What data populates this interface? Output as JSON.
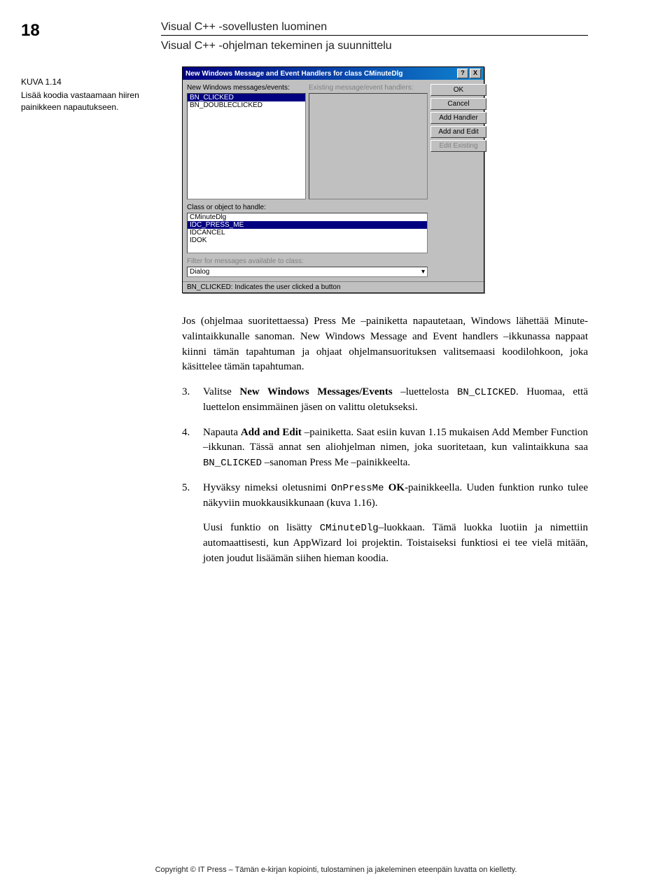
{
  "page_number": "18",
  "header": {
    "title1": "Visual C++ -sovellusten luominen",
    "title2": "Visual C++ -ohjelman tekeminen ja suunnittelu"
  },
  "caption": {
    "label": "KUVA 1.14",
    "text": "Lisää koodia vastaamaan hiiren painikkeen napautukseen."
  },
  "dialog": {
    "title": "New Windows Message and Event Handlers for class CMinuteDlg",
    "help_btn": "?",
    "close_btn": "X",
    "label_messages": "New Windows messages/events:",
    "label_existing": "Existing message/event handlers:",
    "messages_list": [
      "BN_CLICKED",
      "BN_DOUBLECLICKED"
    ],
    "messages_selected": "BN_CLICKED",
    "buttons": {
      "ok": "OK",
      "cancel": "Cancel",
      "add_handler": "Add Handler",
      "add_and_edit": "Add and Edit",
      "edit_existing": "Edit Existing"
    },
    "label_class": "Class or object to handle:",
    "class_list": [
      "CMinuteDlg",
      "IDC_PRESS_ME",
      "IDCANCEL",
      "IDOK"
    ],
    "class_selected": "IDC_PRESS_ME",
    "label_filter": "Filter for messages available to class:",
    "filter_value": "Dialog",
    "statusbar": "BN_CLICKED:  Indicates the user clicked a button"
  },
  "body": {
    "intro": "Jos (ohjelmaa suoritettaessa) Press Me –painiketta napautetaan, Windows lähettää Minute-valintaikkunalle sanoman. New Windows Message and Event handlers –ikkunassa nappaat kiinni tämän tapahtuman ja ohjaat ohjelmansuorituksen valitsemaasi koodilohkoon, joka käsittelee tämän tapahtuman.",
    "item3_pre": "Valitse ",
    "item3_bold": "New Windows Messages/Events",
    "item3_mid": " –luettelosta ",
    "item3_code": "BN_CLICKED",
    "item3_post": ". Huomaa, että luettelon ensimmäinen jäsen on valittu oletukseksi.",
    "item4_pre": "Napauta ",
    "item4_bold": "Add and Edit",
    "item4_mid": " –painiketta. Saat esiin kuvan 1.15 mukaisen Add Member Function –ikkunan. Tässä annat sen aliohjelman nimen, joka suoritetaan, kun valintaikkuna saa ",
    "item4_code": "BN_CLICKED",
    "item4_post": " –sanoman Press Me –painikkeelta.",
    "item5_pre": "Hyväksy nimeksi oletusnimi ",
    "item5_code": "OnPressMe",
    "item5_mid": " ",
    "item5_bold": "OK",
    "item5_post": "-painikkeella. Uuden funktion runko tulee näkyviin muokkausikkunaan (kuva 1.16).",
    "closing_pre": "Uusi funktio on lisätty ",
    "closing_code": "CMinuteDlg",
    "closing_post": "–luokkaan. Tämä luokka luotiin ja nimettiin automaattisesti, kun AppWizard loi projektin. Toistaiseksi funktiosi ei tee vielä mitään, joten joudut lisäämän siihen hieman koodia."
  },
  "footer": "Copyright © IT Press – Tämän e-kirjan kopiointi, tulostaminen ja jakeleminen eteenpäin luvatta on kielletty."
}
